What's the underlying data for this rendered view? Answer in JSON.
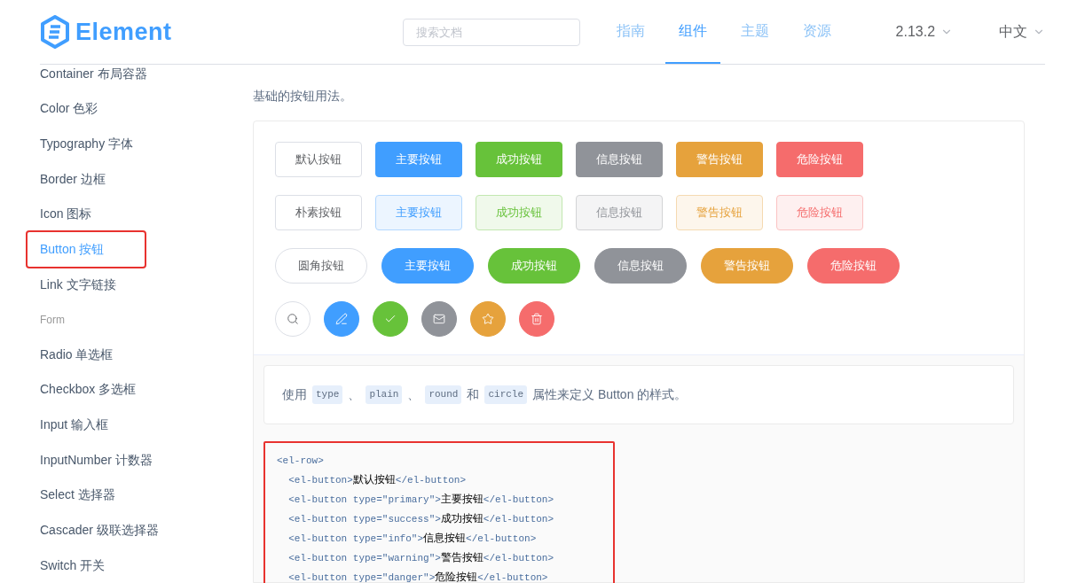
{
  "header": {
    "logo": "Element",
    "search": {
      "placeholder": "搜索文档"
    },
    "nav": [
      {
        "label": "指南",
        "selected": false
      },
      {
        "label": "组件",
        "selected": true
      },
      {
        "label": "主题",
        "selected": false
      },
      {
        "label": "资源",
        "selected": false
      }
    ],
    "version": "2.13.2",
    "language": "中文"
  },
  "sidebar": {
    "items": [
      {
        "kind": "link",
        "label": "Container 布局容器",
        "selected": false,
        "highlighted": false
      },
      {
        "kind": "link",
        "label": "Color 色彩",
        "selected": false,
        "highlighted": false
      },
      {
        "kind": "link",
        "label": "Typography 字体",
        "selected": false,
        "highlighted": false
      },
      {
        "kind": "link",
        "label": "Border 边框",
        "selected": false,
        "highlighted": false
      },
      {
        "kind": "link",
        "label": "Icon 图标",
        "selected": false,
        "highlighted": false
      },
      {
        "kind": "link",
        "label": "Button 按钮",
        "selected": true,
        "highlighted": true
      },
      {
        "kind": "link",
        "label": "Link 文字链接",
        "selected": false,
        "highlighted": false
      },
      {
        "kind": "group",
        "label": "Form"
      },
      {
        "kind": "link",
        "label": "Radio 单选框",
        "selected": false,
        "highlighted": false
      },
      {
        "kind": "link",
        "label": "Checkbox 多选框",
        "selected": false,
        "highlighted": false
      },
      {
        "kind": "link",
        "label": "Input 输入框",
        "selected": false,
        "highlighted": false
      },
      {
        "kind": "link",
        "label": "InputNumber 计数器",
        "selected": false,
        "highlighted": false
      },
      {
        "kind": "link",
        "label": "Select 选择器",
        "selected": false,
        "highlighted": false
      },
      {
        "kind": "link",
        "label": "Cascader 级联选择器",
        "selected": false,
        "highlighted": false
      },
      {
        "kind": "link",
        "label": "Switch 开关",
        "selected": false,
        "highlighted": false
      }
    ]
  },
  "content": {
    "intro": "基础的按钮用法。",
    "demo_rows": [
      {
        "kind": "default",
        "buttons": [
          {
            "kind": "default",
            "label": "默认按钮"
          },
          {
            "kind": "primary",
            "label": "主要按钮"
          },
          {
            "kind": "success",
            "label": "成功按钮"
          },
          {
            "kind": "info",
            "label": "信息按钮"
          },
          {
            "kind": "warning",
            "label": "警告按钮"
          },
          {
            "kind": "danger",
            "label": "危险按钮"
          }
        ]
      },
      {
        "kind": "plain",
        "buttons": [
          {
            "kind": "default",
            "label": "朴素按钮"
          },
          {
            "kind": "primary",
            "label": "主要按钮"
          },
          {
            "kind": "success",
            "label": "成功按钮"
          },
          {
            "kind": "info",
            "label": "信息按钮"
          },
          {
            "kind": "warning",
            "label": "警告按钮"
          },
          {
            "kind": "danger",
            "label": "危险按钮"
          }
        ]
      },
      {
        "kind": "round",
        "buttons": [
          {
            "kind": "default",
            "label": "圆角按钮"
          },
          {
            "kind": "primary",
            "label": "主要按钮"
          },
          {
            "kind": "success",
            "label": "成功按钮"
          },
          {
            "kind": "info",
            "label": "信息按钮"
          },
          {
            "kind": "warning",
            "label": "警告按钮"
          },
          {
            "kind": "danger",
            "label": "危险按钮"
          }
        ]
      },
      {
        "kind": "circle",
        "buttons": [
          {
            "kind": "default"
          },
          {
            "kind": "primary"
          },
          {
            "kind": "success"
          },
          {
            "kind": "info"
          },
          {
            "kind": "warning"
          },
          {
            "kind": "danger"
          }
        ]
      }
    ],
    "description": [
      {
        "kind": "text",
        "text": "使用"
      },
      {
        "kind": "code",
        "text": "type"
      },
      {
        "kind": "text",
        "text": "、"
      },
      {
        "kind": "code",
        "text": "plain"
      },
      {
        "kind": "text",
        "text": "、"
      },
      {
        "kind": "code",
        "text": "round"
      },
      {
        "kind": "text",
        "text": "和"
      },
      {
        "kind": "code",
        "text": "circle"
      },
      {
        "kind": "text",
        "text": "属性来定义 Button 的样式。"
      }
    ],
    "code": {
      "highlighted": true,
      "lines": [
        [
          {
            "kind": "markup",
            "text": "<el-row>"
          }
        ],
        [
          {
            "kind": "markup",
            "text": "  <el-button>"
          },
          {
            "kind": "text",
            "text": "默认按钮"
          },
          {
            "kind": "markup",
            "text": "</el-button>"
          }
        ],
        [
          {
            "kind": "markup",
            "text": "  <el-button type=\"primary\">"
          },
          {
            "kind": "text",
            "text": "主要按钮"
          },
          {
            "kind": "markup",
            "text": "</el-button>"
          }
        ],
        [
          {
            "kind": "markup",
            "text": "  <el-button type=\"success\">"
          },
          {
            "kind": "text",
            "text": "成功按钮"
          },
          {
            "kind": "markup",
            "text": "</el-button>"
          }
        ],
        [
          {
            "kind": "markup",
            "text": "  <el-button type=\"info\">"
          },
          {
            "kind": "text",
            "text": "信息按钮"
          },
          {
            "kind": "markup",
            "text": "</el-button>"
          }
        ],
        [
          {
            "kind": "markup",
            "text": "  <el-button type=\"warning\">"
          },
          {
            "kind": "text",
            "text": "警告按钮"
          },
          {
            "kind": "markup",
            "text": "</el-button>"
          }
        ],
        [
          {
            "kind": "markup",
            "text": "  <el-button type=\"danger\">"
          },
          {
            "kind": "text",
            "text": "危险按钮"
          },
          {
            "kind": "markup",
            "text": "</el-button>"
          }
        ]
      ]
    }
  }
}
